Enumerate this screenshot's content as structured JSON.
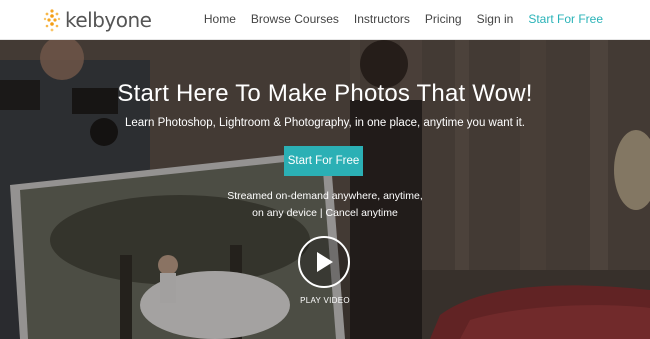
{
  "brand": {
    "name_part1": "kelby",
    "name_part2": "one",
    "accent": "#2ab3b8",
    "logo_icon": "dot-burst-icon"
  },
  "nav": {
    "items": [
      {
        "label": "Home"
      },
      {
        "label": "Browse Courses"
      },
      {
        "label": "Instructors"
      },
      {
        "label": "Pricing"
      },
      {
        "label": "Sign in"
      }
    ],
    "cta_label": "Start For Free"
  },
  "hero": {
    "title": "Start Here To Make Photos That Wow!",
    "subtitle": "Learn Photoshop, Lightroom & Photography, in one place, anytime you want it.",
    "button_label": "Start For Free",
    "stream_line1": "Streamed on-demand anywhere, anytime,",
    "stream_line2": "on any device | Cancel anytime",
    "play_icon": "play-icon",
    "play_label": "PLAY VIDEO"
  }
}
